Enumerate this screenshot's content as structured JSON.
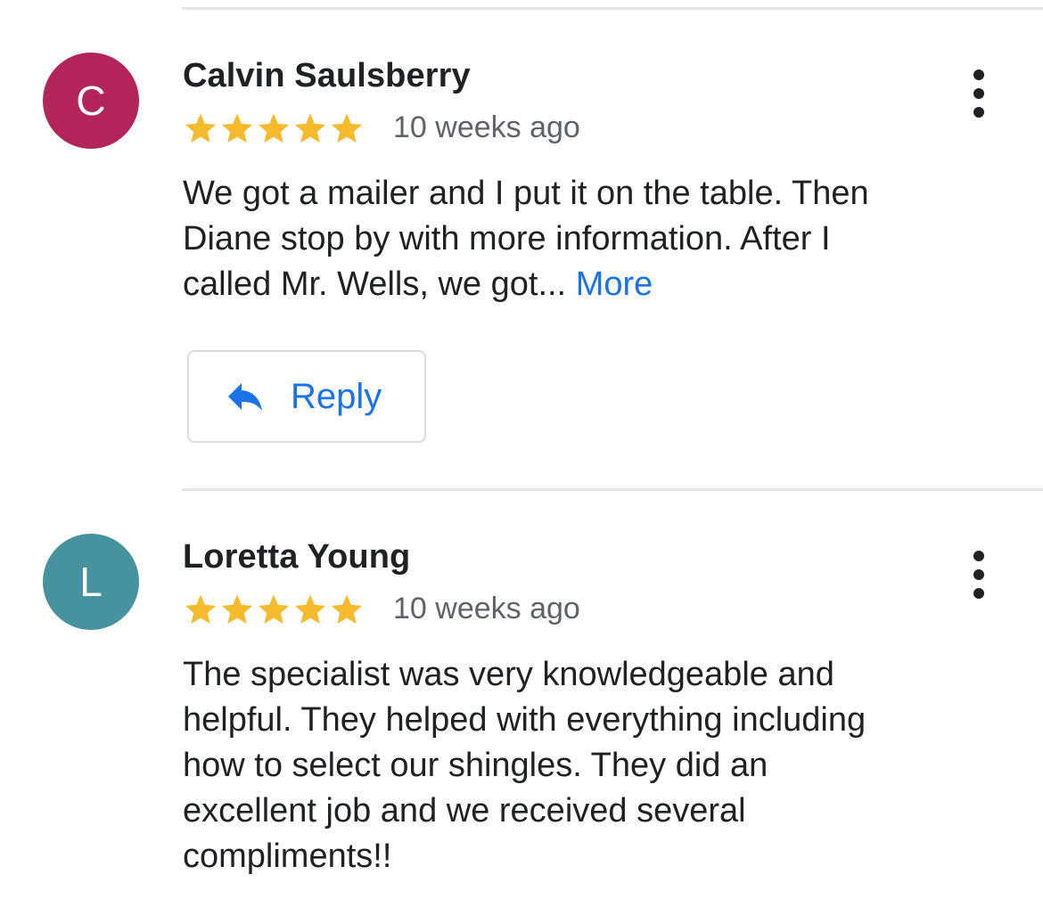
{
  "colors": {
    "star": "#f6bb2d",
    "link": "#1a73e8",
    "meta_text": "#5f6368"
  },
  "reviews": [
    {
      "author": "Calvin Saulsberry",
      "avatar_initial": "C",
      "avatar_color": "#b3245a",
      "rating": 5,
      "time": "10 weeks ago",
      "text_lines": [
        "We got a mailer and I put it on the table. Then",
        "Diane stop by with more information. After I",
        "called Mr. Wells, we got... "
      ],
      "more_label": "More",
      "reply_label": "Reply",
      "reply_icon": "reply-arrow-icon",
      "menu_icon": "more-vert-icon"
    },
    {
      "author": "Loretta Young",
      "avatar_initial": "L",
      "avatar_color": "#47929f",
      "rating": 5,
      "time": "10 weeks ago",
      "text_lines": [
        "The specialist was very knowledgeable and",
        "helpful. They helped with everything including",
        "how to select our shingles. They did an",
        "excellent job and we received several",
        "compliments!!"
      ],
      "menu_icon": "more-vert-icon"
    }
  ]
}
